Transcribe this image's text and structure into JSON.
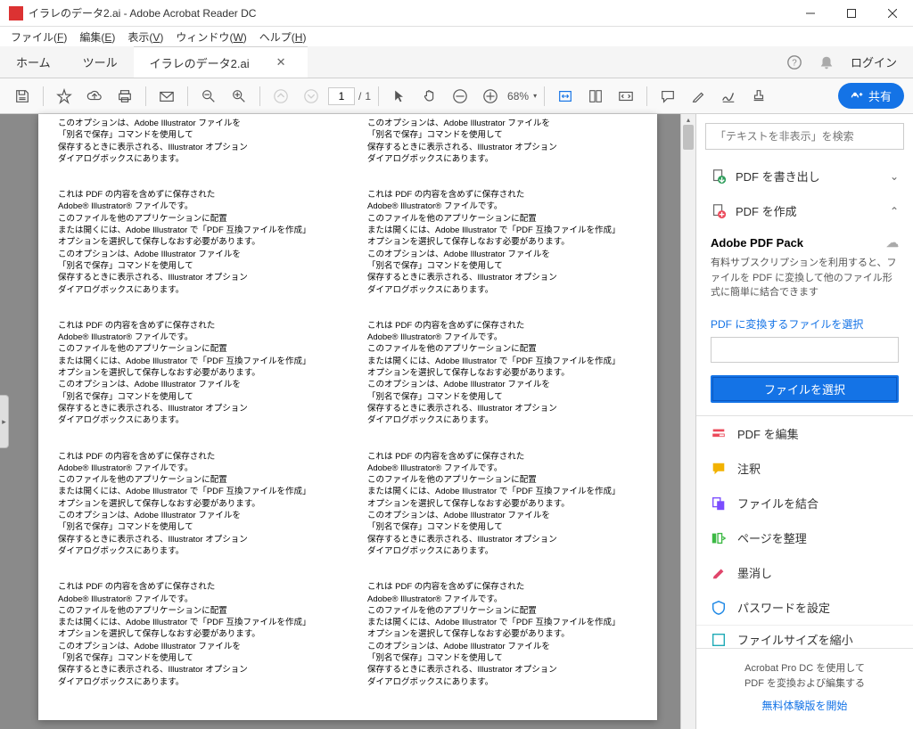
{
  "window": {
    "title": "イラレのデータ2.ai - Adobe Acrobat Reader DC"
  },
  "menu": {
    "file": "ファイル",
    "file_u": "F",
    "edit": "編集",
    "edit_u": "E",
    "view": "表示",
    "view_u": "V",
    "window": "ウィンドウ",
    "window_u": "W",
    "help": "ヘルプ",
    "help_u": "H"
  },
  "tabs": {
    "home": "ホーム",
    "tools": "ツール",
    "doc": "イラレのデータ2.ai"
  },
  "topright": {
    "login": "ログイン"
  },
  "toolbar": {
    "page_current": "1",
    "page_sep": "/",
    "page_total": "1",
    "zoom": "68%",
    "share": "共有"
  },
  "document": {
    "block1": [
      "このオプションは、Adobe Illustrator ファイルを",
      "「別名で保存」コマンドを使用して",
      "保存するときに表示される、Illustrator オプション",
      "ダイアログボックスにあります。"
    ],
    "block2": [
      "これは PDF の内容を含めずに保存された",
      "Adobe® Illustrator® ファイルです。",
      "このファイルを他のアプリケーションに配置",
      "または開くには、Adobe Illustrator で「PDF 互換ファイルを作成」",
      "オプションを選択して保存しなおす必要があります。",
      "このオプションは、Adobe Illustrator ファイルを",
      "「別名で保存」コマンドを使用して",
      "保存するときに表示される、Illustrator オプション",
      "ダイアログボックスにあります。"
    ]
  },
  "taskpane": {
    "search_placeholder": "「テキストを非表示」を検索",
    "export_pdf": "PDF を書き出し",
    "create_pdf": "PDF を作成",
    "pack_title": "Adobe PDF Pack",
    "pack_desc": "有料サブスクリプションを利用すると、ファイルを PDF に変換して他のファイル形式に簡単に結合できます",
    "select_file_link": "PDF に変換するファイルを選択",
    "select_file_btn": "ファイルを選択",
    "tools": [
      {
        "label": "PDF を編集",
        "color": "#ec4a5b"
      },
      {
        "label": "注釈",
        "color": "#f2b200"
      },
      {
        "label": "ファイルを結合",
        "color": "#7b4cff"
      },
      {
        "label": "ページを整理",
        "color": "#3cb944"
      },
      {
        "label": "墨消し",
        "color": "#e0456b"
      },
      {
        "label": "パスワードを設定",
        "color": "#1e88e5"
      }
    ],
    "cutoff_label": "ファイルサイズを縮小",
    "cutoff_color": "#1aa8b5",
    "footer_line1": "Acrobat Pro DC を使用して",
    "footer_line2": "PDF を変換および編集する",
    "footer_link": "無料体験版を開始"
  }
}
